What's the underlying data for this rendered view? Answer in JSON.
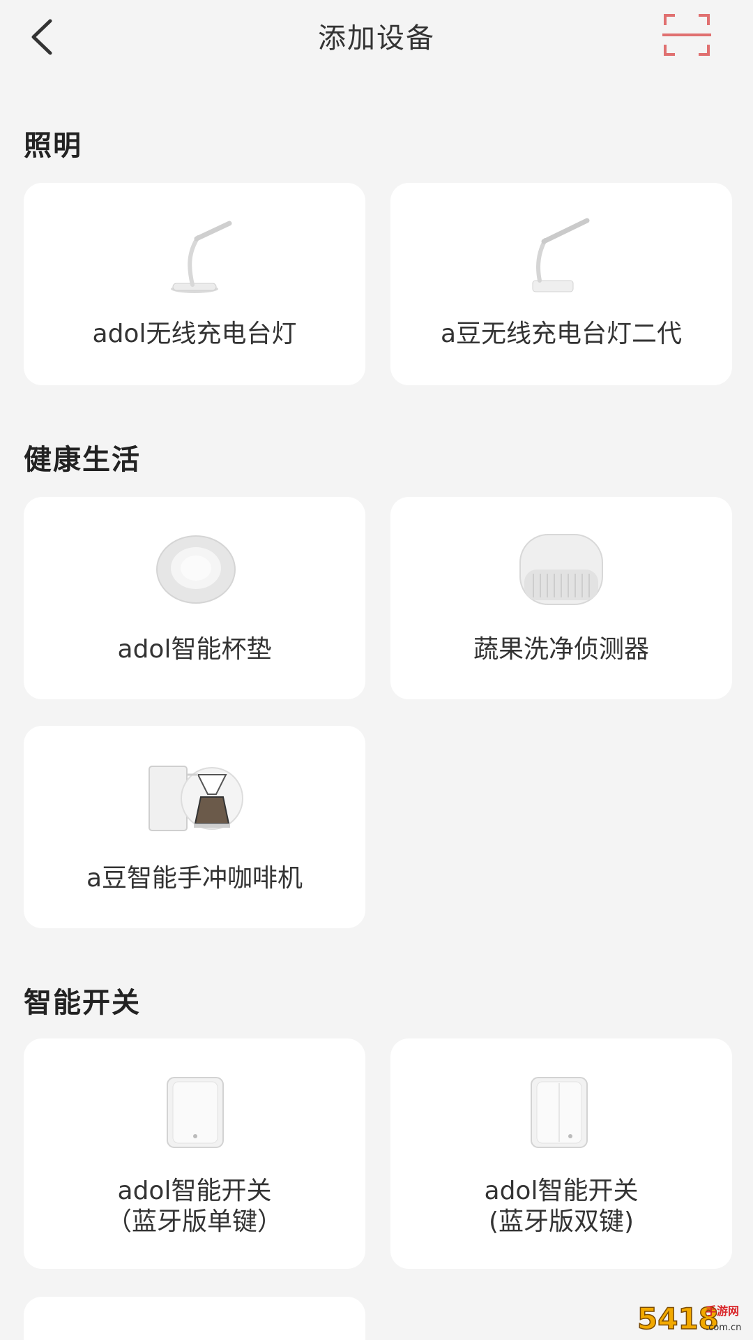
{
  "header": {
    "title": "添加设备",
    "back_icon": "chevron-left-icon",
    "scan_icon": "scan-icon",
    "scan_color": "#e06666"
  },
  "sections": [
    {
      "title": "照明",
      "devices": [
        {
          "name": "adol无线充电台灯",
          "icon": "desk-lamp"
        },
        {
          "name": "a豆无线充电台灯二代",
          "icon": "desk-lamp"
        }
      ]
    },
    {
      "title": "健康生活",
      "devices": [
        {
          "name": "adol智能杯垫",
          "icon": "cup-coaster"
        },
        {
          "name": "蔬果洗净侦测器",
          "icon": "produce-detector"
        },
        {
          "name": "a豆智能手冲咖啡机",
          "icon": "pour-over-coffee-machine"
        }
      ]
    },
    {
      "title": "智能开关",
      "devices": [
        {
          "name": "adol智能开关",
          "subname": "（蓝牙版单键）",
          "icon": "wall-switch"
        },
        {
          "name": "adol智能开关",
          "subname": "(蓝牙版双键)",
          "icon": "wall-switch"
        }
      ]
    }
  ],
  "watermark": {
    "text": "5418",
    "subtext": "手游网",
    "domain": ".com.cn",
    "color": "#f2a900"
  }
}
